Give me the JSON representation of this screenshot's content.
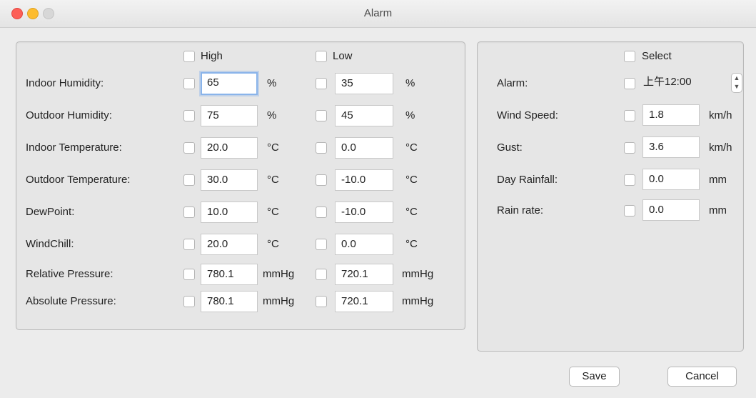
{
  "window": {
    "title": "Alarm"
  },
  "left": {
    "high_header": "High",
    "low_header": "Low",
    "rows": [
      {
        "label": "Indoor Humidity:",
        "high": "65",
        "high_unit": "%",
        "low": "35",
        "low_unit": "%"
      },
      {
        "label": "Outdoor Humidity:",
        "high": "75",
        "high_unit": "%",
        "low": "45",
        "low_unit": "%"
      },
      {
        "label": "Indoor Temperature:",
        "high": "20.0",
        "high_unit": "°C",
        "low": "0.0",
        "low_unit": "°C"
      },
      {
        "label": "Outdoor Temperature:",
        "high": "30.0",
        "high_unit": "°C",
        "low": "-10.0",
        "low_unit": "°C"
      },
      {
        "label": "DewPoint:",
        "high": "10.0",
        "high_unit": "°C",
        "low": "-10.0",
        "low_unit": "°C"
      },
      {
        "label": "WindChill:",
        "high": "20.0",
        "high_unit": "°C",
        "low": "0.0",
        "low_unit": "°C"
      },
      {
        "label": "Relative Pressure:",
        "high": "780.1",
        "high_unit": "mmHg",
        "low": "720.1",
        "low_unit": "mmHg"
      },
      {
        "label": "Absolute Pressure:",
        "high": "780.1",
        "high_unit": "mmHg",
        "low": "720.1",
        "low_unit": "mmHg"
      }
    ]
  },
  "right": {
    "select_header": "Select",
    "alarm": {
      "label": "Alarm:",
      "value": "上午12:00"
    },
    "rows": [
      {
        "label": "Wind Speed:",
        "value": "1.8",
        "unit": "km/h"
      },
      {
        "label": "Gust:",
        "value": "3.6",
        "unit": "km/h"
      },
      {
        "label": "Day Rainfall:",
        "value": "0.0",
        "unit": "mm"
      },
      {
        "label": "Rain rate:",
        "value": "0.0",
        "unit": "mm"
      }
    ]
  },
  "buttons": {
    "save": "Save",
    "cancel": "Cancel"
  }
}
